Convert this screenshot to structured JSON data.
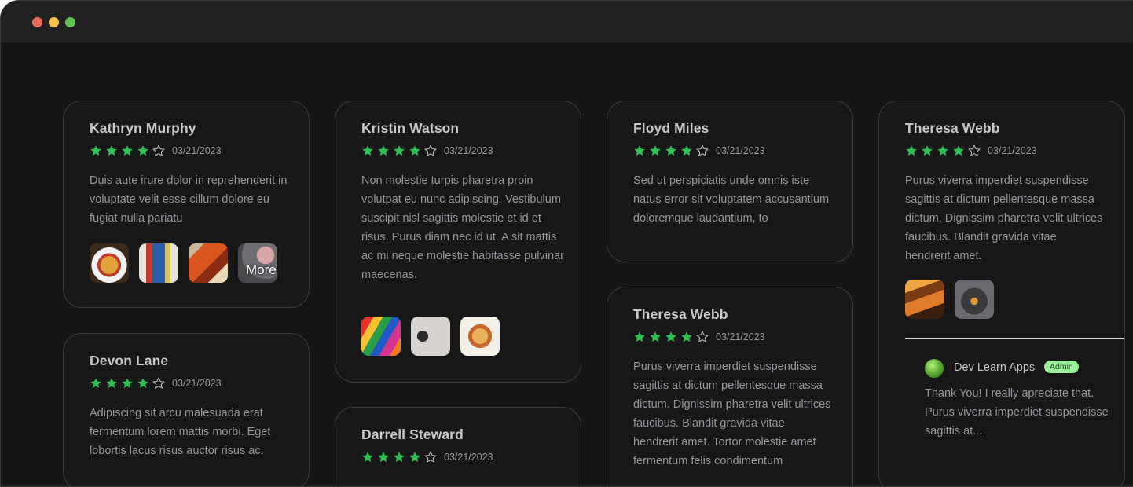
{
  "window": {
    "controls": [
      "close",
      "minimize",
      "zoom"
    ]
  },
  "colors": {
    "star_filled": "#2dbf52",
    "star_empty": "#bdbdbd",
    "admin_badge": "#9cf09a"
  },
  "reviews": [
    {
      "name": "Kathryn Murphy",
      "rating": 4,
      "max_rating": 5,
      "date": "03/21/2023",
      "text": "Duis aute irure dolor in reprehenderit in voluptate velit esse cillum dolore eu fugiat nulla pariatu",
      "images": [
        "food-bowl-photo",
        "art-gallery-photo",
        "painting-photo",
        "blurred-photo"
      ],
      "more_label": "More+"
    },
    {
      "name": "Devon Lane",
      "rating": 4,
      "max_rating": 5,
      "date": "03/21/2023",
      "text": "Adipiscing sit arcu malesuada erat fermentum lorem mattis morbi. Eget lobortis lacus risus auctor risus ac."
    },
    {
      "name": "Kristin Watson",
      "rating": 4,
      "max_rating": 5,
      "date": "03/21/2023",
      "text": "Non molestie turpis pharetra proin volutpat eu nunc adipiscing. Vestibulum suscipit nisl sagittis molestie et id et risus. Purus diam nec id ut. A sit mattis ac mi neque molestie habitasse pulvinar maecenas.",
      "images": [
        "colorful-art-photo",
        "coffee-cups-photo",
        "pasta-dish-photo"
      ]
    },
    {
      "name": "Darrell Steward",
      "rating": 4,
      "max_rating": 5,
      "date": "03/21/2023"
    },
    {
      "name": "Floyd Miles",
      "rating": 4,
      "max_rating": 5,
      "date": "03/21/2023",
      "text": "Sed ut perspiciatis unde omnis iste natus error sit voluptatem accusantium doloremque laudantium, to"
    },
    {
      "name": "Theresa Webb",
      "rating": 4,
      "max_rating": 5,
      "date": "03/21/2023",
      "text": "Purus viverra imperdiet suspendisse sagittis at dictum pellentesque massa dictum. Dignissim pharetra velit ultrices faucibus. Blandit gravida vitae hendrerit amet. Tortor molestie amet fermentum felis condimentum"
    },
    {
      "name": "Theresa Webb",
      "rating": 4,
      "max_rating": 5,
      "date": "03/21/2023",
      "text": "Purus viverra imperdiet suspendisse sagittis at dictum pellentesque massa dictum. Dignissim pharetra velit ultrices faucibus. Blandit gravida vitae hendrerit amet.",
      "images": [
        "grilled-food-photo",
        "dark-plate-photo"
      ],
      "reply": {
        "author": "Dev Learn Apps",
        "badge": "Admin",
        "text": "Thank You! I really apreciate that. Purus viverra imperdiet suspendisse sagittis at..."
      }
    }
  ]
}
